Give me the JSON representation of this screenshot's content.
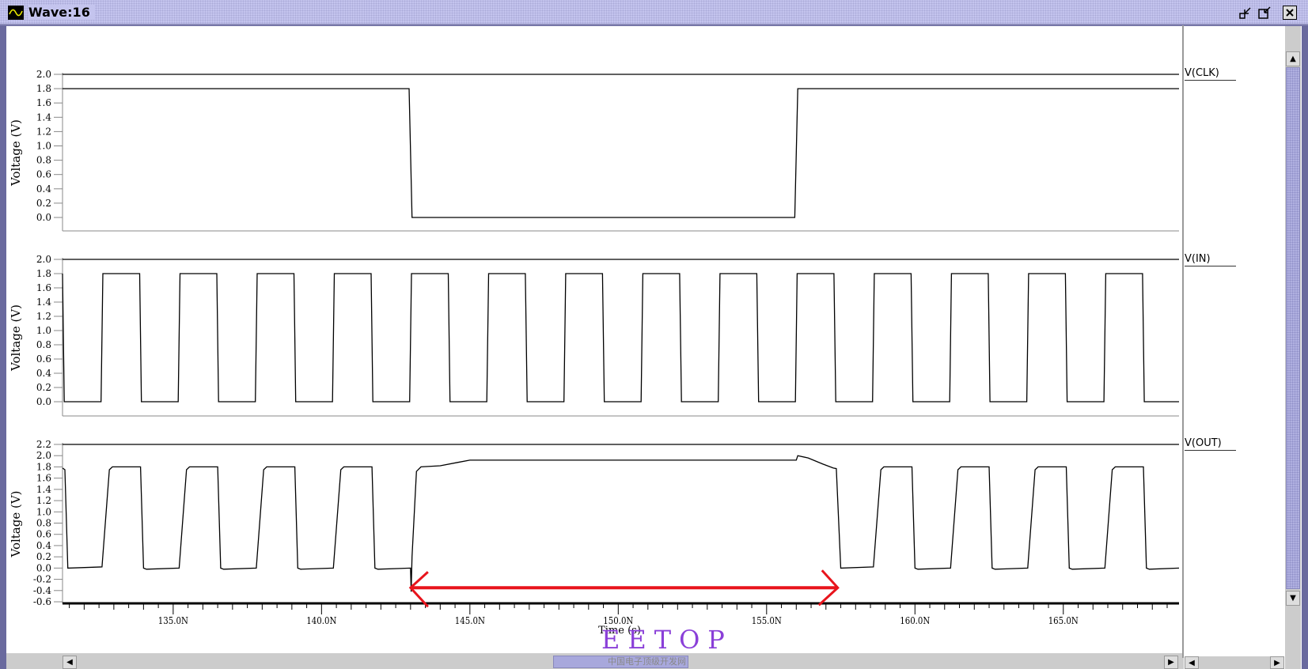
{
  "window": {
    "title": "Wave:16",
    "icon": "sine-wave-icon",
    "buttons": [
      "minimize-icon",
      "restore-icon",
      "close-icon"
    ]
  },
  "watermark": {
    "text": "EETOP",
    "subtitle": "中国电子顶级开发网"
  },
  "colors": {
    "trace": "#000000",
    "annotation": "#e8141c",
    "title_bar": "#c4c4ee",
    "watermark": "#8a3fd8"
  },
  "annotation": {
    "type": "double-arrow",
    "from_ns": 143.0,
    "to_ns": 157.4,
    "at_volts": -0.35
  },
  "chart_data": {
    "type": "line",
    "xlabel": "Time (s)",
    "xlim": [
      131.27,
      168.9
    ],
    "xunit": "ns",
    "xticks": [
      135,
      140,
      145,
      150,
      155,
      160,
      165
    ],
    "xtick_labels": [
      "135.0N",
      "140.0N",
      "145.0N",
      "150.0N",
      "155.0N",
      "160.0N",
      "165.0N"
    ],
    "panels": [
      {
        "name": "V(CLK)",
        "ylabel": "Voltage (V)",
        "ylim": [
          0.0,
          2.0
        ],
        "yticks": [
          "2.0",
          "1.8",
          "1.6",
          "1.4",
          "1.2",
          "1.0",
          "0.8",
          "0.6",
          "0.4",
          "0.2",
          "0.0"
        ],
        "points": [
          [
            131.27,
            1.8
          ],
          [
            142.95,
            1.8
          ],
          [
            143.05,
            0.0
          ],
          [
            155.95,
            0.0
          ],
          [
            156.05,
            1.8
          ],
          [
            168.9,
            1.8
          ]
        ]
      },
      {
        "name": "V(IN)",
        "ylabel": "Voltage (V)",
        "ylim": [
          0.0,
          2.0
        ],
        "yticks": [
          "2.0",
          "1.8",
          "1.6",
          "1.4",
          "1.2",
          "1.0",
          "0.8",
          "0.6",
          "0.4",
          "0.2",
          "0.0"
        ],
        "pulse": {
          "high": 1.8,
          "low": 0.0,
          "first_rise": 130.0,
          "period": 2.6,
          "width": 1.3
        }
      },
      {
        "name": "V(OUT)",
        "ylabel": "Voltage (V)",
        "ylim": [
          -0.6,
          2.2
        ],
        "yticks": [
          "2.2",
          "2.0",
          "1.8",
          "1.6",
          "1.4",
          "1.2",
          "1.0",
          "0.8",
          "0.6",
          "0.4",
          "0.2",
          "0.0",
          "-0.2",
          "-0.4",
          "-0.6"
        ],
        "points": [
          [
            131.27,
            1.78
          ],
          [
            131.35,
            1.75
          ],
          [
            131.45,
            0.0
          ],
          [
            132.6,
            0.02
          ],
          [
            132.85,
            1.75
          ],
          [
            132.95,
            1.8
          ],
          [
            133.9,
            1.8
          ],
          [
            134.0,
            0.0
          ],
          [
            134.1,
            -0.02
          ],
          [
            135.2,
            0.0
          ],
          [
            135.45,
            1.75
          ],
          [
            135.55,
            1.8
          ],
          [
            136.5,
            1.8
          ],
          [
            136.6,
            0.0
          ],
          [
            136.7,
            -0.02
          ],
          [
            137.8,
            0.0
          ],
          [
            138.05,
            1.75
          ],
          [
            138.15,
            1.8
          ],
          [
            139.1,
            1.8
          ],
          [
            139.2,
            0.0
          ],
          [
            139.3,
            -0.02
          ],
          [
            140.4,
            0.0
          ],
          [
            140.65,
            1.75
          ],
          [
            140.75,
            1.8
          ],
          [
            141.7,
            1.8
          ],
          [
            141.8,
            0.0
          ],
          [
            141.9,
            -0.02
          ],
          [
            143.0,
            0.0
          ],
          [
            143.02,
            -0.42
          ],
          [
            143.05,
            0.2
          ],
          [
            143.2,
            1.72
          ],
          [
            143.35,
            1.8
          ],
          [
            144.0,
            1.82
          ],
          [
            144.6,
            1.88
          ],
          [
            145.0,
            1.92
          ],
          [
            156.0,
            1.92
          ],
          [
            156.05,
            2.0
          ],
          [
            156.4,
            1.96
          ],
          [
            156.9,
            1.85
          ],
          [
            157.25,
            1.78
          ],
          [
            157.35,
            1.77
          ],
          [
            157.5,
            0.0
          ],
          [
            158.6,
            0.02
          ],
          [
            158.85,
            1.75
          ],
          [
            158.95,
            1.8
          ],
          [
            159.9,
            1.8
          ],
          [
            160.0,
            0.0
          ],
          [
            160.1,
            -0.02
          ],
          [
            161.2,
            0.0
          ],
          [
            161.45,
            1.75
          ],
          [
            161.55,
            1.8
          ],
          [
            162.5,
            1.8
          ],
          [
            162.6,
            0.0
          ],
          [
            162.7,
            -0.02
          ],
          [
            163.8,
            0.0
          ],
          [
            164.05,
            1.75
          ],
          [
            164.15,
            1.8
          ],
          [
            165.1,
            1.8
          ],
          [
            165.2,
            0.0
          ],
          [
            165.3,
            -0.02
          ],
          [
            166.4,
            0.0
          ],
          [
            166.65,
            1.75
          ],
          [
            166.75,
            1.8
          ],
          [
            167.7,
            1.8
          ],
          [
            167.8,
            0.0
          ],
          [
            167.9,
            -0.02
          ],
          [
            168.9,
            0.0
          ]
        ]
      }
    ]
  }
}
